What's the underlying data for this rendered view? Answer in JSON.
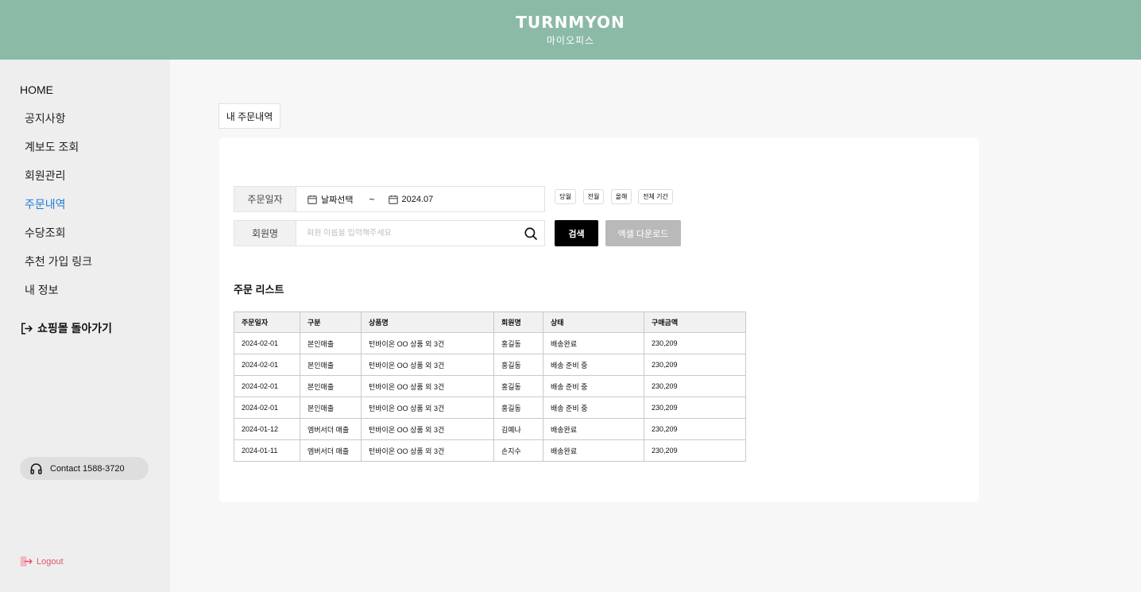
{
  "header": {
    "logo": "TURNMYON",
    "subtitle": "마이오피스"
  },
  "sidebar": {
    "home": "HOME",
    "items": [
      {
        "label": "공지사항",
        "active": false
      },
      {
        "label": "계보도 조회",
        "active": false
      },
      {
        "label": "회원관리",
        "active": false
      },
      {
        "label": "주문내역",
        "active": true
      },
      {
        "label": "수당조회",
        "active": false
      },
      {
        "label": "추천 가입 링크",
        "active": false
      },
      {
        "label": "내 정보",
        "active": false
      }
    ],
    "shop_back": "쇼핑몰 돌아가기",
    "contact": "Contact 1588-3720",
    "logout": "Logout"
  },
  "page_tab": "내 주문내역",
  "filters": {
    "date_label": "주문일자",
    "date_from": "날짜선택",
    "tilde": "~",
    "date_to": "2024.07",
    "quick": [
      "당월",
      "전월",
      "올해",
      "전체 기간"
    ],
    "member_label": "회원명",
    "member_placeholder": "회원 이름을 입력해주세요",
    "search_button": "검색",
    "excel_button": "엑셀 다운로드"
  },
  "list": {
    "title": "주문 리스트",
    "columns": [
      "주문일자",
      "구분",
      "상품명",
      "회원명",
      "상태",
      "구매금액"
    ],
    "rows": [
      [
        "2024-02-01",
        "본인매출",
        "턴바이온 OO 상품 외 3건",
        "홍길동",
        "배송완료",
        "230,209"
      ],
      [
        "2024-02-01",
        "본인매출",
        "턴바이온 OO 상품 외 3건",
        "홍길동",
        "배송 준비 중",
        "230,209"
      ],
      [
        "2024-02-01",
        "본인매출",
        "턴바이온 OO 상품 외 3건",
        "홍길동",
        "배송 준비 중",
        "230,209"
      ],
      [
        "2024-02-01",
        "본인매출",
        "턴바이온 OO 상품 외 3건",
        "홍길동",
        "배송 준비 중",
        "230,209"
      ],
      [
        "2024-01-12",
        "엠버서더 매출",
        "턴바이온 OO 상품 외 3건",
        "김예나",
        "배송완료",
        "230,209"
      ],
      [
        "2024-01-11",
        "엠버서더 매출",
        "턴바이온 OO 상품 외 3건",
        "손지수",
        "배송완료",
        "230,209"
      ]
    ]
  },
  "colors": {
    "header_bg": "#8bbaa6",
    "active_nav": "#1f7bd6",
    "logout": "#e0566a",
    "excel_button": "#b9b9b9"
  }
}
